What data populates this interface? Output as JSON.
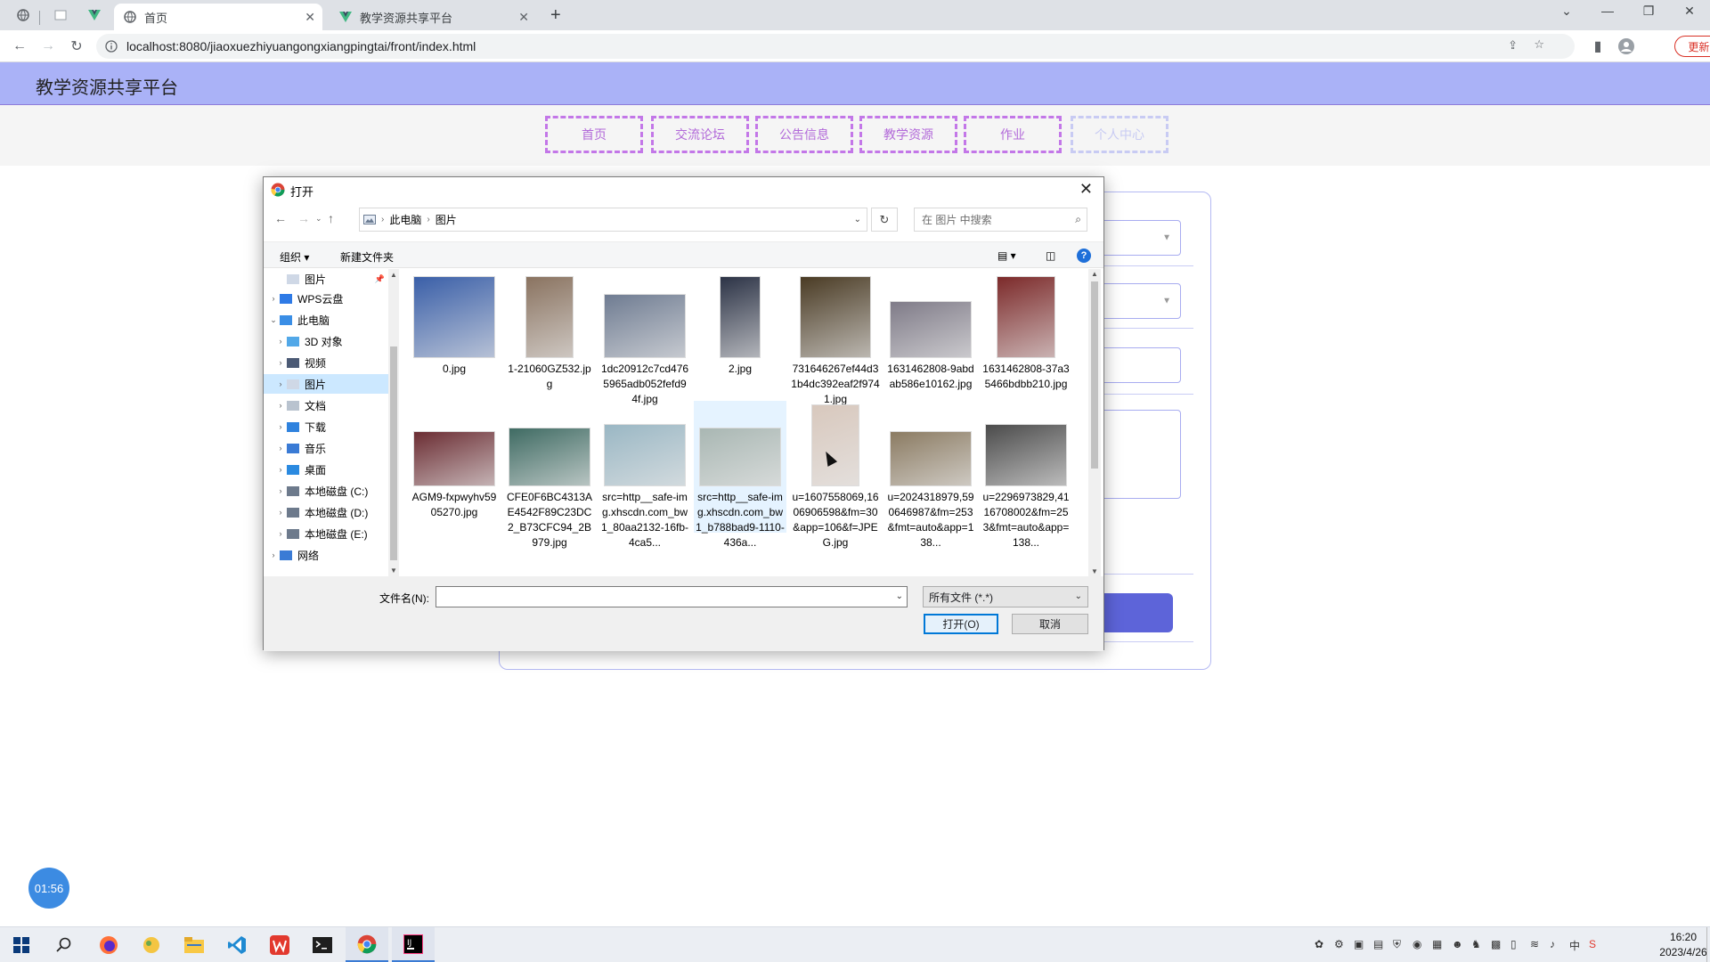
{
  "browser": {
    "tabs": [
      {
        "label": "首页",
        "active": true
      },
      {
        "label": "教学资源共享平台",
        "active": false
      }
    ],
    "url": "localhost:8080/jiaoxuezhiyuangongxiangpingtai/front/index.html",
    "update_label": "更新"
  },
  "site": {
    "title": "教学资源共享平台",
    "nav": [
      "首页",
      "交流论坛",
      "公告信息",
      "教学资源",
      "作业",
      "个人中心"
    ]
  },
  "timer": "01:56",
  "dialog": {
    "title": "打开",
    "breadcrumb": [
      "此电脑",
      "图片"
    ],
    "search_placeholder": "在 图片 中搜索",
    "organize_label": "组织",
    "new_folder_label": "新建文件夹",
    "help_label": "?",
    "tree": [
      {
        "label": "图片",
        "level": 1,
        "expand": "",
        "pinned": true
      },
      {
        "label": "WPS云盘",
        "level": 0,
        "expand": "›"
      },
      {
        "label": "此电脑",
        "level": 0,
        "expand": "⌄"
      },
      {
        "label": "3D 对象",
        "level": 1,
        "expand": "›"
      },
      {
        "label": "视频",
        "level": 1,
        "expand": "›"
      },
      {
        "label": "图片",
        "level": 1,
        "expand": "›",
        "selected": true
      },
      {
        "label": "文档",
        "level": 1,
        "expand": "›"
      },
      {
        "label": "下载",
        "level": 1,
        "expand": "›"
      },
      {
        "label": "音乐",
        "level": 1,
        "expand": "›"
      },
      {
        "label": "桌面",
        "level": 1,
        "expand": "›"
      },
      {
        "label": "本地磁盘 (C:)",
        "level": 1,
        "expand": "›"
      },
      {
        "label": "本地磁盘 (D:)",
        "level": 1,
        "expand": "›"
      },
      {
        "label": "本地磁盘 (E:)",
        "level": 1,
        "expand": "›"
      },
      {
        "label": "网络",
        "level": 0,
        "expand": "›"
      }
    ],
    "files": [
      {
        "name": "0.jpg",
        "color": "#3a5fa8"
      },
      {
        "name": "1-21060GZ532.jpg",
        "color": "#8a7360"
      },
      {
        "name": "1dc20912c7cd4765965adb052fefd94f.jpg",
        "color": "#6f7c92"
      },
      {
        "name": "2.jpg",
        "color": "#2c3346"
      },
      {
        "name": "731646267ef44d31b4dc392eaf2f9741.jpg",
        "color": "#4a3b24"
      },
      {
        "name": "1631462808-9abdab586e10162.jpg",
        "color": "#7f7b88"
      },
      {
        "name": "1631462808-37a35466bdbb210.jpg",
        "color": "#7c2a2a"
      },
      {
        "name": "AGM9-fxpwyhv5905270.jpg",
        "color": "#6b2d33"
      },
      {
        "name": "CFE0F6BC4313AE4542F89C23DC2_B73CFC94_2B979.jpg",
        "color": "#3f6b63"
      },
      {
        "name": "src=http__safe-img.xhscdn.com_bw1_80aa2132-16fb-4ca5...",
        "color": "#9ab7c4"
      },
      {
        "name": "src=http__safe-img.xhscdn.com_bw1_b788bad9-1110-436a...",
        "color": "#a9b7b3",
        "selected": true
      },
      {
        "name": "u=1607558069,1606906598&fm=30&app=106&f=JPEG.jpg",
        "color": "#d8c8bd"
      },
      {
        "name": "u=2024318979,590646987&fm=253&fmt=auto&app=138...",
        "color": "#8b7b62"
      },
      {
        "name": "u=2296973829,4116708002&fm=253&fmt=auto&app=138...",
        "color": "#4b4b4b"
      },
      {
        "name": "",
        "color": "#c8b7b0"
      }
    ],
    "filename_label": "文件名(N):",
    "filename_value": "",
    "filetype": "所有文件 (*.*)",
    "open_label": "打开(O)",
    "cancel_label": "取消"
  },
  "taskbar": {
    "tray_lang": "中",
    "time": "16:20",
    "date": "2023/4/26"
  },
  "colors": {
    "header_bg": "#aab2f7",
    "nav_border": "#c377e8",
    "accent_button": "#5d64d9",
    "timer_bg": "#3c8be2"
  }
}
